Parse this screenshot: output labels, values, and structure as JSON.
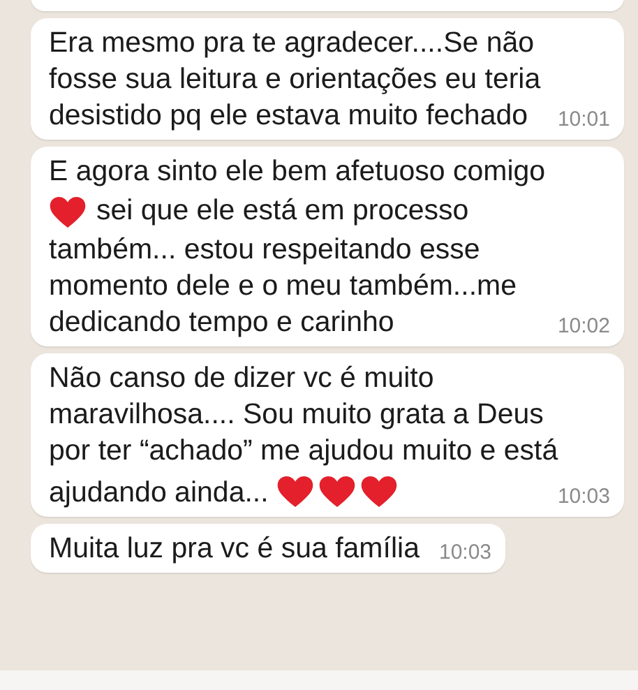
{
  "messages": [
    {
      "kind": "partial"
    },
    {
      "kind": "full",
      "lines": [
        [
          {
            "kind": "text",
            "text": "Era mesmo pra te agradecer....Se não"
          }
        ],
        [
          {
            "kind": "text",
            "text": "fosse sua leitura e orientações eu teria"
          }
        ],
        [
          {
            "kind": "text",
            "text": "desistido pq ele estava muito fechado"
          }
        ]
      ],
      "time": "10:01"
    },
    {
      "kind": "full",
      "lines": [
        [
          {
            "kind": "text",
            "text": "E agora sinto ele bem afetuoso comigo"
          }
        ],
        [
          {
            "kind": "heart"
          },
          {
            "kind": "text",
            "text": "sei que ele está em processo"
          }
        ],
        [
          {
            "kind": "text",
            "text": "também... estou respeitando esse"
          }
        ],
        [
          {
            "kind": "text",
            "text": "momento dele e o meu também...me"
          }
        ],
        [
          {
            "kind": "text",
            "text": "dedicando tempo e carinho"
          }
        ]
      ],
      "time": "10:02"
    },
    {
      "kind": "full",
      "lines": [
        [
          {
            "kind": "text",
            "text": "Não canso de dizer vc é muito"
          }
        ],
        [
          {
            "kind": "text",
            "text": "maravilhosa.... Sou muito grata a Deus"
          }
        ],
        [
          {
            "kind": "text",
            "text": "por ter “achado” me ajudou muito e está"
          }
        ],
        [
          {
            "kind": "text",
            "text": "ajudando ainda..."
          },
          {
            "kind": "heart"
          },
          {
            "kind": "heart"
          },
          {
            "kind": "heart"
          }
        ]
      ],
      "time": "10:03"
    },
    {
      "kind": "full",
      "lines": [
        [
          {
            "kind": "text",
            "text": "Muita luz pra vc é sua família"
          }
        ]
      ],
      "time": "10:03"
    }
  ]
}
